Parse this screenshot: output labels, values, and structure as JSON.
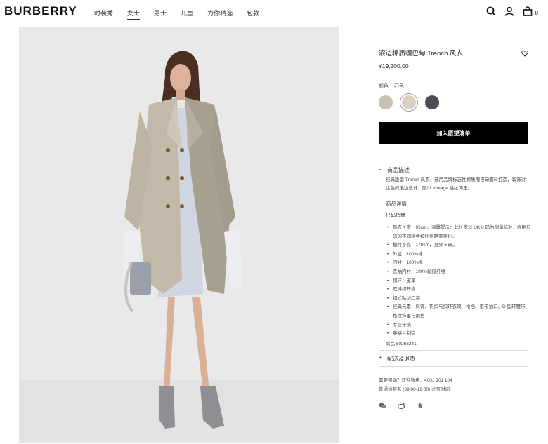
{
  "header": {
    "logo": "BURBERRY",
    "nav": [
      "时装秀",
      "女士",
      "男士",
      "儿童",
      "为你精选",
      "包款"
    ],
    "bag_count": "0"
  },
  "product": {
    "title": "滚边棉质嘎巴甸 Trench 风衣",
    "price": "¥19,200.00",
    "color_label": "颜色",
    "color_value": "石色",
    "swatches": [
      "#c7c0b4",
      "#d8d1c3",
      "#4a4d56"
    ],
    "cta": "加入愿望清单"
  },
  "description": {
    "heading": "商品描述",
    "text": "经典版型 Trench 风衣，选用品牌标志性棉质嘎巴甸面料打造，装饰对比色的滚边设计，配以 Vintage 格纹饰里。",
    "details_heading": "商品详情",
    "size_guide": "尺码指南",
    "specs": [
      "风衣长度：95cm。温馨提示：此长度以 UK 8 码为测量标准，根据尺码的不同将会按比例略有变化。",
      "模特身高：179cm，身穿 6 码。",
      "外层：100%棉",
      "内衬：100%棉",
      "衣袖内衬：100%黏胶纤维",
      "扣环：皮革",
      "双排扣开襟",
      "扣式贴边口袋",
      "经典元素：肩饰、钩扣与扣环衣领、枪挡、束带袖口、D 型环腰带、格纹饰里与雨挡",
      "专业干洗",
      "英格兰制造"
    ],
    "code": "商品 80263241"
  },
  "shipping": {
    "heading": "配送及退货"
  },
  "help": {
    "line1": "需要帮助？欢迎致电：4001 201 104",
    "line2": "普通话服务 (09:00-19:00) 北京时间"
  }
}
